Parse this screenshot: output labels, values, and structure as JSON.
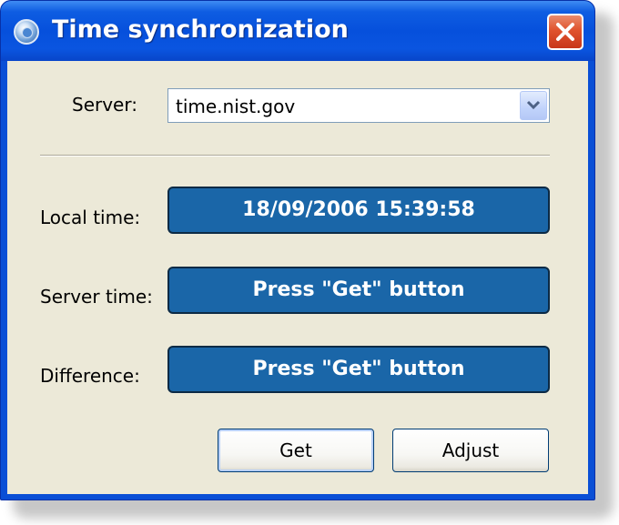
{
  "window": {
    "title": "Time synchronization",
    "icon": "clock-globe-icon",
    "close_icon": "close-x-icon"
  },
  "server": {
    "label": "Server:",
    "selected_value": "time.nist.gov",
    "dropdown_icon": "chevron-down-icon"
  },
  "rows": {
    "local_time": {
      "label": "Local time:",
      "value": "18/09/2006 15:39:58"
    },
    "server_time": {
      "label": "Server time:",
      "value": "Press \"Get\" button"
    },
    "difference": {
      "label": "Difference:",
      "value": "Press \"Get\" button"
    }
  },
  "buttons": {
    "get_label": "Get",
    "adjust_label": "Adjust"
  },
  "colors": {
    "titlebar": "#0650dc",
    "client_bg": "#ece9d8",
    "display_bg": "#1a66a8",
    "display_text": "#ffffff",
    "close_button": "#e0532e"
  }
}
